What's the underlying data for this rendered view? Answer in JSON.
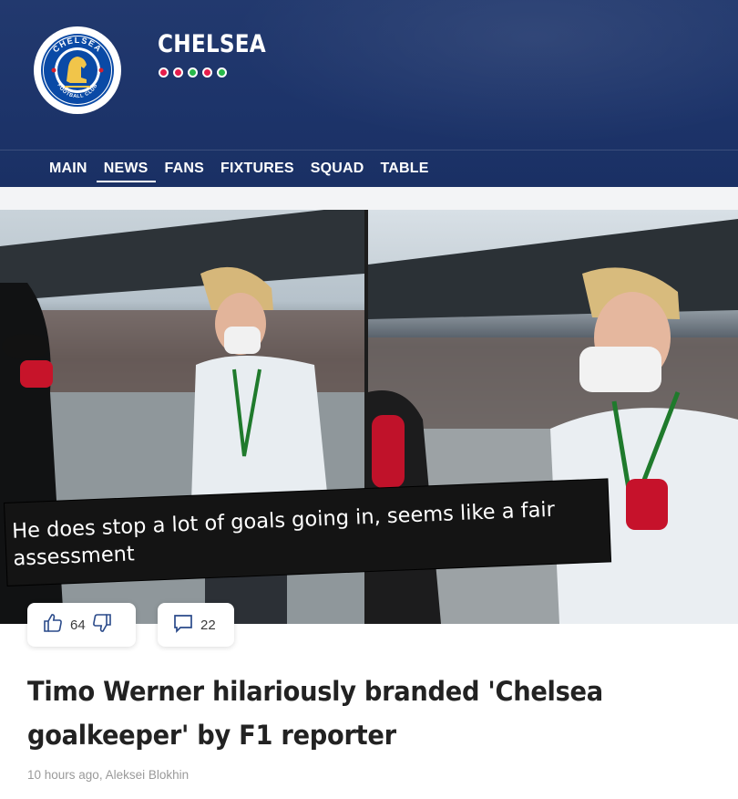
{
  "header": {
    "club_name": "CHELSEA",
    "logo": {
      "ring_text": "CHELSEA",
      "bottom_text": "FOOTBALL CLUB",
      "icon": "chelsea-lion-crest"
    },
    "dots": [
      "#e61c4b",
      "#e61c4b",
      "#28b84a",
      "#e61c4b",
      "#28b84a"
    ]
  },
  "nav": {
    "items": [
      {
        "label": "MAIN",
        "active": false
      },
      {
        "label": "NEWS",
        "active": true
      },
      {
        "label": "FANS",
        "active": false
      },
      {
        "label": "FIXTURES",
        "active": false
      },
      {
        "label": "SQUAD",
        "active": false
      },
      {
        "label": "TABLE",
        "active": false
      }
    ]
  },
  "article": {
    "image_caption": "He does stop a lot of goals going in, seems like a fair assessment",
    "likes": "64",
    "comments": "22",
    "title": "Timo Werner hilariously branded 'Chelsea goalkeeper' by F1 reporter",
    "time": "10 hours ago",
    "author": "Aleksei Blokhin"
  },
  "icons": {
    "like": "thumbs-up-icon",
    "dislike": "thumbs-down-icon",
    "comment": "comment-icon"
  },
  "colors": {
    "header_bg": "#1d346a",
    "page_bg": "#f3f4f6",
    "accent_icon": "#2a4a8a"
  }
}
